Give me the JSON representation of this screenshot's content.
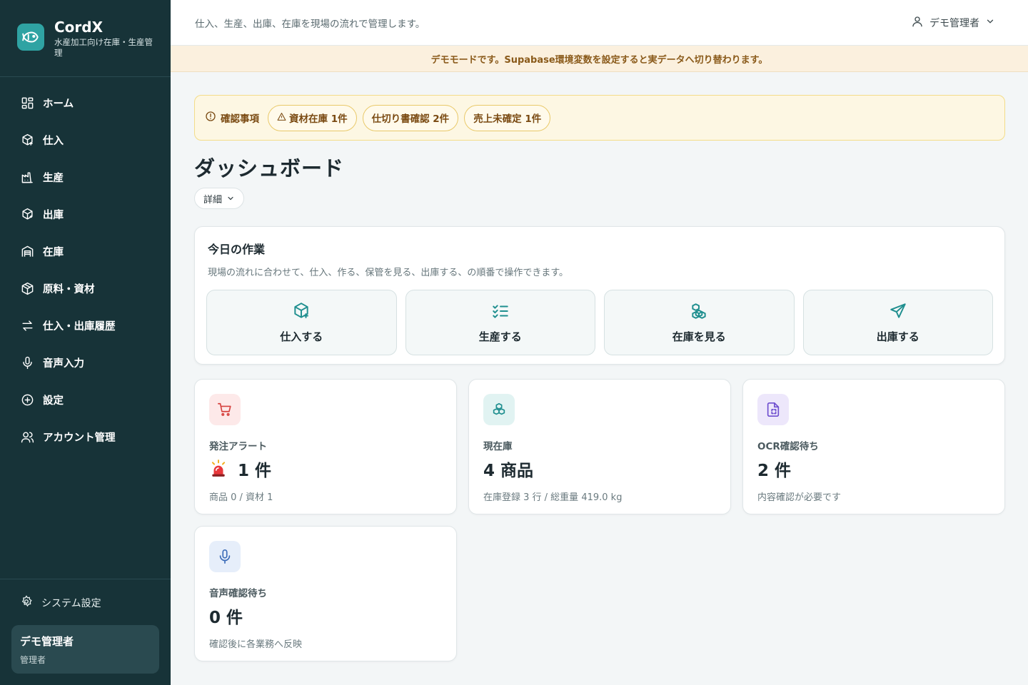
{
  "sidebar": {
    "brand_name": "CordX",
    "brand_sub": "水産加工向け在庫・生産管理",
    "items": [
      {
        "label": "ホーム",
        "icon": "grid-icon"
      },
      {
        "label": "仕入",
        "icon": "package-plus-icon"
      },
      {
        "label": "生産",
        "icon": "factory-icon"
      },
      {
        "label": "出庫",
        "icon": "package-out-icon"
      },
      {
        "label": "在庫",
        "icon": "warehouse-icon"
      },
      {
        "label": "原料・資材",
        "icon": "boxes-icon"
      },
      {
        "label": "仕入・出庫履歴",
        "icon": "arrows-icon"
      },
      {
        "label": "音声入力",
        "icon": "mic-icon"
      },
      {
        "label": "設定",
        "icon": "plus-circle-icon"
      },
      {
        "label": "アカウント管理",
        "icon": "users-icon"
      }
    ],
    "system_settings": "システム設定",
    "user_name": "デモ管理者",
    "user_role": "管理者"
  },
  "topbar": {
    "description": "仕入、生産、出庫、在庫を現場の流れで管理します。",
    "user_label": "デモ管理者"
  },
  "banner": "デモモードです。Supabase環境変数を設定すると実データへ切り替わります。",
  "notice": {
    "title": "確認事項",
    "pills": [
      {
        "label": "資材在庫 1件",
        "warn": true
      },
      {
        "label": "仕切り書確認 2件",
        "warn": false
      },
      {
        "label": "売上未確定 1件",
        "warn": false
      }
    ]
  },
  "page_title": "ダッシュボード",
  "detail_button": "詳細",
  "today": {
    "title": "今日の作業",
    "description": "現場の流れに合わせて、仕入、作る、保管を見る、出庫する、の順番で操作できます。",
    "actions": [
      {
        "label": "仕入する",
        "icon": "package-plus-icon"
      },
      {
        "label": "生産する",
        "icon": "list-checks-icon"
      },
      {
        "label": "在庫を見る",
        "icon": "boxes-icon"
      },
      {
        "label": "出庫する",
        "icon": "send-icon"
      }
    ]
  },
  "cards": [
    {
      "label": "発注アラート",
      "value": "1 件",
      "sub": "商品 0 / 資材 1",
      "icon": "cart-icon",
      "siren": true
    },
    {
      "label": "現在庫",
      "value": "4 商品",
      "sub": "在庫登録 3 行 / 総重量 419.0 kg",
      "icon": "boxes-icon"
    },
    {
      "label": "OCR確認待ち",
      "value": "2 件",
      "sub": "内容確認が必要です",
      "icon": "file-scan-icon"
    },
    {
      "label": "音声確認待ち",
      "value": "0 件",
      "sub": "確認後に各業務へ反映",
      "icon": "mic-icon"
    }
  ],
  "colors": {
    "sidebar_bg": "#173338",
    "accent": "#1f8f8f",
    "banner_bg": "#fbf0de",
    "notice_bg": "#fdf7e3"
  }
}
